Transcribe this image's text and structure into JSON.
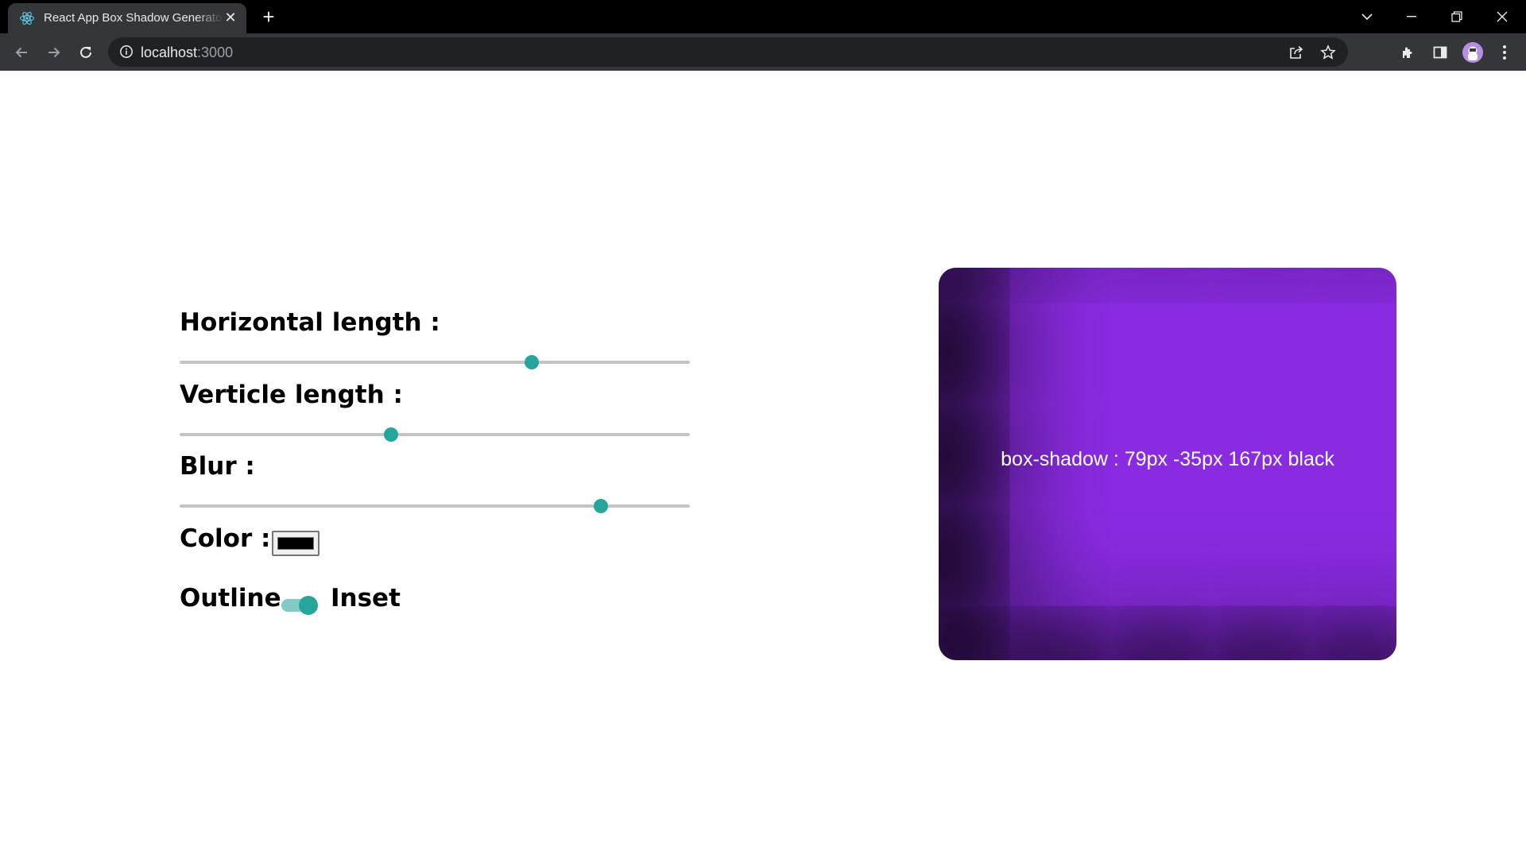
{
  "browser": {
    "tab_title": "React App Box Shadow Generator",
    "url_host": "localhost",
    "url_port": ":3000",
    "favicon": "react-icon",
    "new_tab_label": "+",
    "close_tab_glyph": "✕"
  },
  "controls": {
    "horizontal_label": "Horizontal length :",
    "vertical_label": "Verticle length :",
    "blur_label": "Blur :",
    "color_label": "Color :",
    "outline_label": "Outline",
    "inset_label": "Inset"
  },
  "values": {
    "horizontal_percent": 69,
    "vertical_percent": 41.5,
    "blur_percent": 82.5,
    "shadow_color": "#000000",
    "inset_enabled": true
  },
  "preview": {
    "text": "box-shadow : 79px -35px 167px black",
    "background_color": "#8a2be2"
  },
  "colors": {
    "accent": "#26a69a",
    "accent_light": "#80cbc4",
    "rail": "#c4c4c4"
  }
}
